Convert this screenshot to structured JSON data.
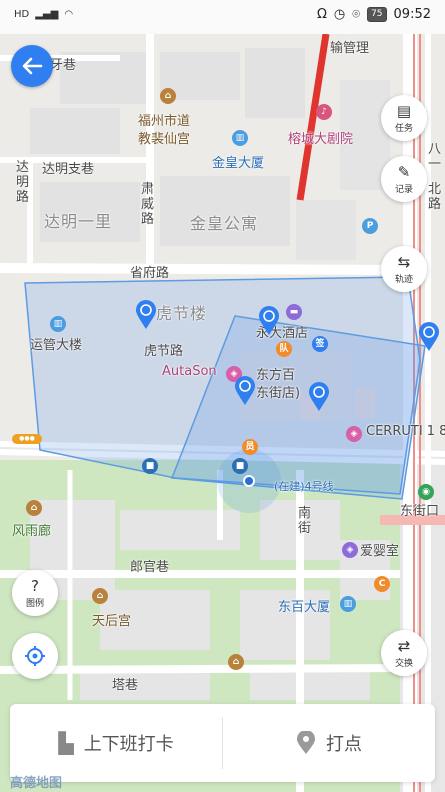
{
  "status_bar": {
    "left": [
      "HD",
      "4G",
      "|||",
      "wifi"
    ],
    "battery": "75",
    "time": "09:52"
  },
  "map": {
    "labels": {
      "ya_xiang": "牙巷",
      "shuyun_guanli": "输管理",
      "fuzhou_shidao": "福州市道",
      "jiaoshu_xiangong": "教裴仙宫",
      "rongcheng_juyuan": "榕城大剧院",
      "jinhuang_dasha": "金皇大厦",
      "daming_zhixiang": "达明支巷",
      "daming_lu": "达明路",
      "daming_yili": "达明一里",
      "suwei_lu": "肃威路",
      "jinhuang_gongyu": "金皇公寓",
      "shengfu_lu": "省府路",
      "hujie_lou": "虎节楼",
      "yunguan_dalou": "运管大楼",
      "yongda_jiudian": "永大酒店",
      "hujie_lu": "虎节路",
      "autason": "AutaSon",
      "dongfang_baihuo": "东方百",
      "dongjie_dian": "东街店)",
      "cerruti": "CERRUTI 1 8",
      "metro_line": "(在建)4号线",
      "nan_jie": "南街",
      "dongjie_kou": "东街口",
      "feng_yu_lang": "风雨廊",
      "langguan_xiang": "郎官巷",
      "ai_ying_shi": "爱婴室",
      "tianhou_gong": "天后宫",
      "dongbai_dasha": "东百大厦",
      "ta_xiang": "塔巷",
      "ba_yi": "八一",
      "bei_lu": "北路",
      "marker_dui": "队",
      "marker_qian": "签",
      "marker_yuan": "员",
      "marker_c": "C"
    }
  },
  "buttons": {
    "task": "任务",
    "record": "记录",
    "track": "轨迹",
    "legend": "图例",
    "swap": "交换"
  },
  "bottom_bar": {
    "clock_in": "上下班打卡",
    "punch": "打点"
  },
  "map_logo": "高德地图"
}
